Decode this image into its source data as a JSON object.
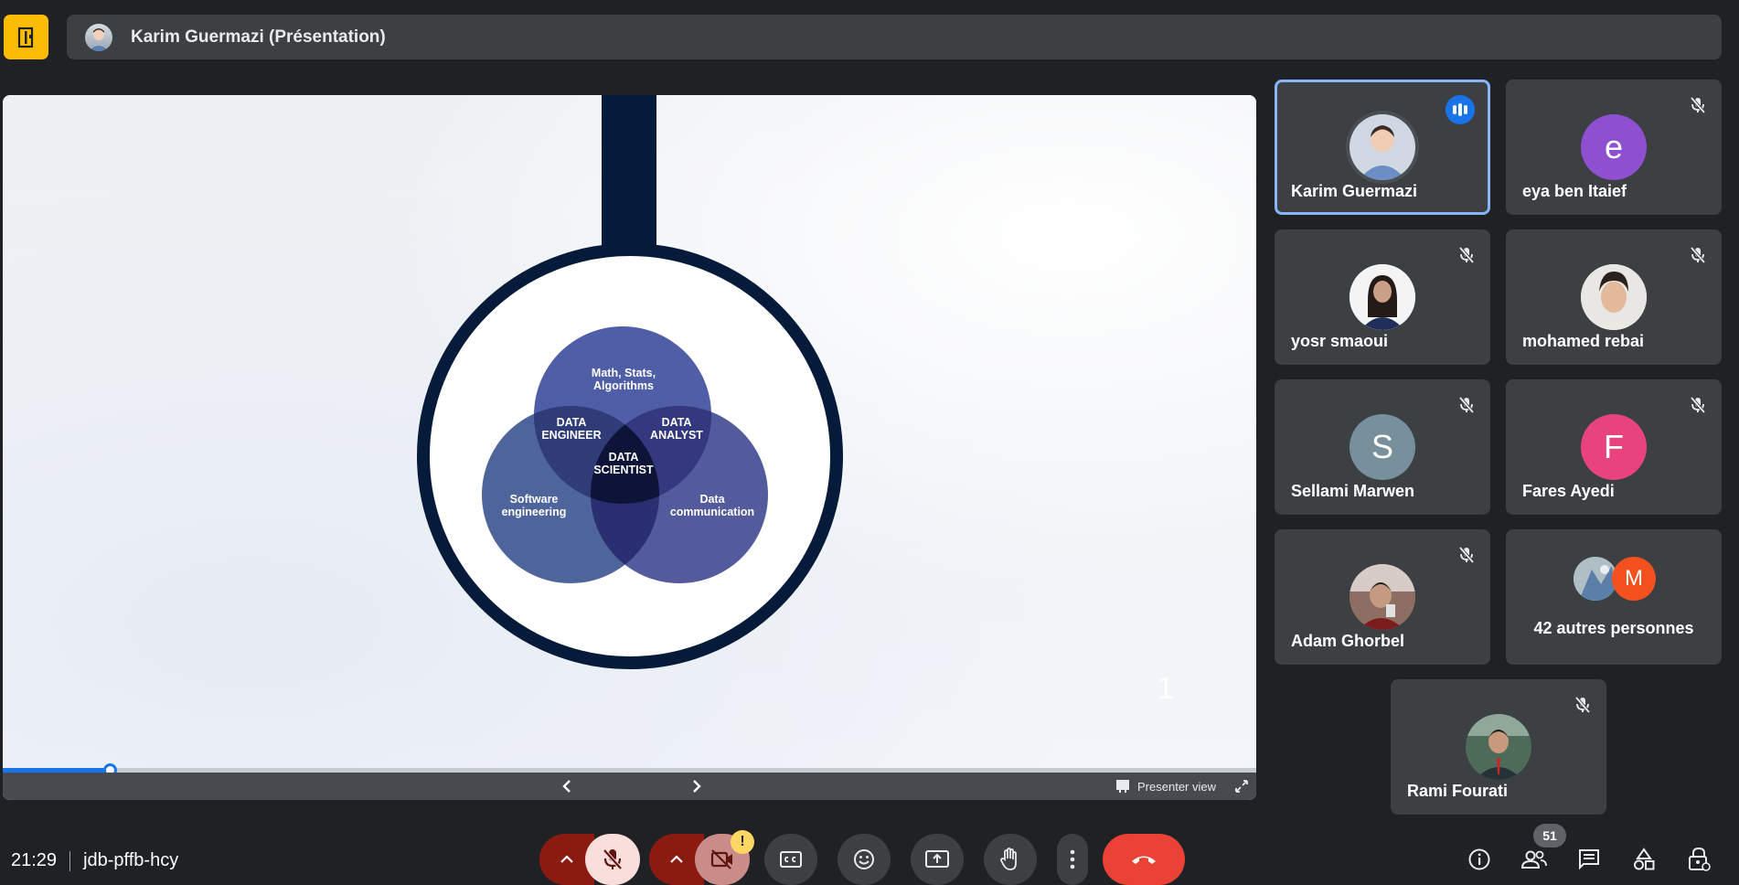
{
  "header": {
    "presenter_title": "Karim Guermazi (Présentation)"
  },
  "slide": {
    "venn": {
      "top_circle": "Math, Stats, Algorithms",
      "top_circle_line1": "Math, Stats,",
      "top_circle_line2": "Algorithms",
      "left_circle_line1": "Software",
      "left_circle_line2": "engineering",
      "right_circle_line1": "Data",
      "right_circle_line2": "communication",
      "overlap_left_line1": "DATA",
      "overlap_left_line2": "ENGINEER",
      "overlap_right_line1": "DATA",
      "overlap_right_line2": "ANALYST",
      "center_line1": "DATA",
      "center_line2": "SCIENTIST"
    },
    "page_number": "1",
    "progress_fraction": 0.085,
    "presenter_view_label": "Presenter view"
  },
  "participants": [
    {
      "name": "Karim Guermazi",
      "initial": "",
      "color": "",
      "speaking": true
    },
    {
      "name": "eya ben Itaief",
      "initial": "e",
      "color": "#8e4fd1",
      "muted": true
    },
    {
      "name": "yosr smaoui",
      "initial": "",
      "color": "",
      "muted": true
    },
    {
      "name": "mohamed rebai",
      "initial": "",
      "color": "",
      "muted": true
    },
    {
      "name": "Sellami Marwen",
      "initial": "S",
      "color": "#78909c",
      "muted": true
    },
    {
      "name": "Fares Ayedi",
      "initial": "F",
      "color": "#e8437c",
      "muted": true
    },
    {
      "name": "Adam Ghorbel",
      "initial": "",
      "color": "",
      "muted": true
    },
    {
      "name": "Rami Fourati",
      "initial": "",
      "color": "",
      "muted": true
    }
  ],
  "others": {
    "label": "42 autres personnes",
    "initial": "M",
    "initial_color": "#f4511e"
  },
  "footer": {
    "time": "21:29",
    "meeting_code": "jdb-pffb-hcy",
    "warning_mark": "!",
    "people_count": "51"
  },
  "colors": {
    "accent": "#1a73e8",
    "hangup": "#ea4335",
    "navy": "#061a3a"
  }
}
